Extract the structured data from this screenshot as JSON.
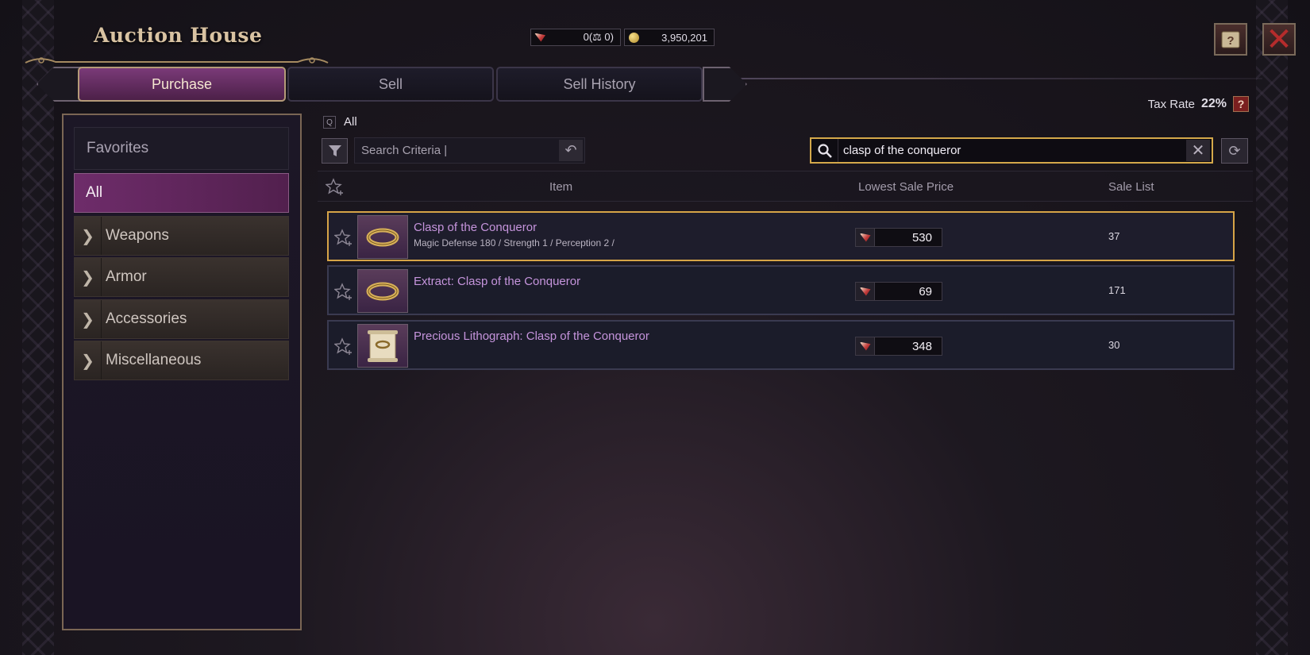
{
  "header": {
    "title": "Auction House",
    "currency_ruby": "0(⚖ 0)",
    "currency_gold": "3,950,201"
  },
  "tabs": [
    "Purchase",
    "Sell",
    "Sell History"
  ],
  "active_tab": "Purchase",
  "tax": {
    "label": "Tax Rate",
    "value": "22%",
    "help": "?"
  },
  "sidebar": {
    "favorites": "Favorites",
    "all": "All",
    "categories": [
      "Weapons",
      "Armor",
      "Accessories",
      "Miscellaneous"
    ]
  },
  "filter": {
    "chip": "Q",
    "scope": "All",
    "criteria_placeholder": "Search Criteria  |"
  },
  "search": {
    "value": "clasp of the conqueror"
  },
  "table": {
    "columns": [
      "Item",
      "Lowest Sale Price",
      "Sale List"
    ],
    "rows": [
      {
        "name": "Clasp of the Conqueror",
        "desc": "Magic Defense 180 / Strength 1 / Perception 2 /",
        "price": "530",
        "count": "37",
        "selected": true
      },
      {
        "name": "Extract: Clasp of the Conqueror",
        "desc": "",
        "price": "69",
        "count": "171",
        "selected": false
      },
      {
        "name": "Precious Lithograph: Clasp of the Conqueror",
        "desc": "",
        "price": "348",
        "count": "30",
        "selected": false
      }
    ]
  },
  "colors": {
    "accent_purple": "#6e2c6a",
    "gold_border": "#d6a447",
    "item_name": "#c594dc"
  },
  "icons": [
    "ruby-currency-icon",
    "gold-coin-icon",
    "help-book-icon",
    "close-icon",
    "filter-icon",
    "reset-icon",
    "search-icon",
    "clear-icon",
    "refresh-icon",
    "favorite-star-icon",
    "chevron-right-icon"
  ]
}
